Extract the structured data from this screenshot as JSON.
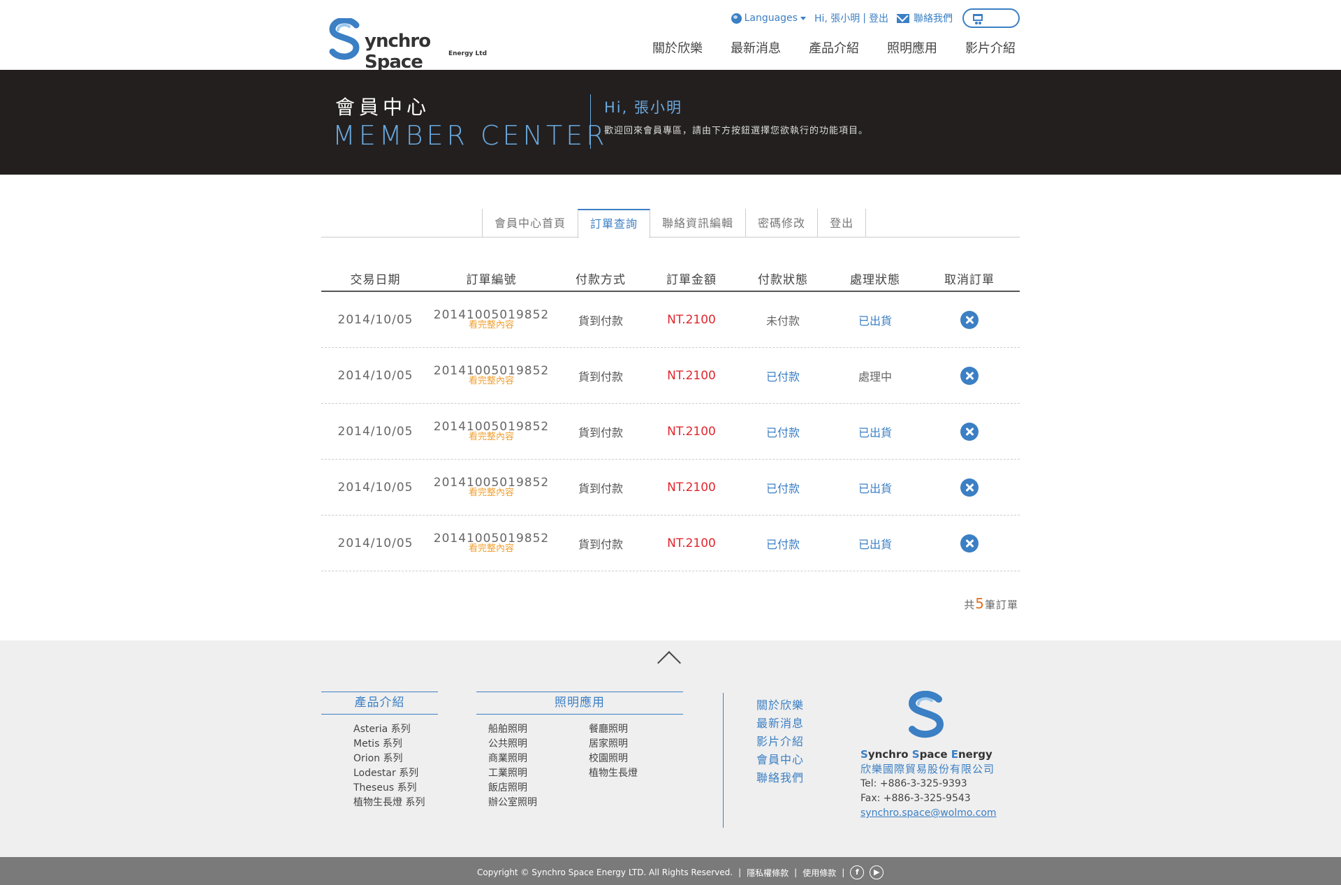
{
  "header": {
    "logo_text": "ynchro Space",
    "logo_sub": "Energy Ltd",
    "languages": "Languages",
    "greeting": "Hi, 張小明",
    "logout": "登出",
    "contact": "聯絡我們",
    "nav": [
      "關於欣樂",
      "最新消息",
      "產品介紹",
      "照明應用",
      "影片介紹"
    ]
  },
  "banner": {
    "title_cn": "會員中心",
    "title_en": "MEMBER CENTER",
    "hi": "Hi, 張小明",
    "desc": "歡迎回來會員專區，請由下方按鈕選擇您欲執行的功能項目。"
  },
  "tabs": [
    "會員中心首頁",
    "訂單查詢",
    "聯絡資訊編輯",
    "密碼修改",
    "登出"
  ],
  "table": {
    "headers": [
      "交易日期",
      "訂單編號",
      "付款方式",
      "訂單金額",
      "付款狀態",
      "處理狀態",
      "取消訂單"
    ],
    "link_label": "看完整內容",
    "rows": [
      {
        "date": "2014/10/05",
        "order_no": "20141005019852",
        "method": "貨到付款",
        "amount": "NT.2100",
        "pay_status": "未付款",
        "process": "已出貨",
        "pay_color": "#666666",
        "proc_color": "#3b7fc4"
      },
      {
        "date": "2014/10/05",
        "order_no": "20141005019852",
        "method": "貨到付款",
        "amount": "NT.2100",
        "pay_status": "已付款",
        "process": "處理中",
        "pay_color": "#3b7fc4",
        "proc_color": "#666666"
      },
      {
        "date": "2014/10/05",
        "order_no": "20141005019852",
        "method": "貨到付款",
        "amount": "NT.2100",
        "pay_status": "已付款",
        "process": "已出貨",
        "pay_color": "#3b7fc4",
        "proc_color": "#3b7fc4"
      },
      {
        "date": "2014/10/05",
        "order_no": "20141005019852",
        "method": "貨到付款",
        "amount": "NT.2100",
        "pay_status": "已付款",
        "process": "已出貨",
        "pay_color": "#3b7fc4",
        "proc_color": "#3b7fc4"
      },
      {
        "date": "2014/10/05",
        "order_no": "20141005019852",
        "method": "貨到付款",
        "amount": "NT.2100",
        "pay_status": "已付款",
        "process": "已出貨",
        "pay_color": "#3b7fc4",
        "proc_color": "#3b7fc4"
      }
    ]
  },
  "total": {
    "prefix": "共",
    "count": "5",
    "suffix": "筆訂單"
  },
  "footer": {
    "products_title": "產品介紹",
    "products": [
      "Asteria 系列",
      "Metis 系列",
      "Orion 系列",
      "Lodestar 系列",
      "Theseus 系列",
      "植物生長燈 系列"
    ],
    "lighting_title": "照明應用",
    "lighting_col1": [
      "船舶照明",
      "公共照明",
      "商業照明",
      "工業照明",
      "飯店照明",
      "辦公室照明"
    ],
    "lighting_col2": [
      "餐廳照明",
      "居家照明",
      "校園照明",
      "植物生長燈"
    ],
    "nav": [
      "關於欣樂",
      "最新消息",
      "影片介紹",
      "會員中心",
      "聯絡我們"
    ],
    "brand_s1": "S",
    "brand_w1": "ynchro ",
    "brand_s2": "S",
    "brand_w2": "pace ",
    "brand_s3": "E",
    "brand_w3": "nergy",
    "company": "欣樂國際貿易股份有限公司",
    "tel": "Tel: +886-3-325-9393",
    "fax": "Fax: +886-3-325-9543",
    "email": "synchro.space@wolmo.com"
  },
  "copyright": {
    "text": "Copyright © Synchro Space Energy LTD. All Rights Reserved.",
    "privacy": "隱私權條款",
    "terms": "使用條款",
    "facebook": "f",
    "youtube": "▶"
  },
  "colors": {
    "accent": "#3b7fc4",
    "banner_bg": "#231f1f",
    "amount": "#e0262d",
    "link": "#f0a030"
  },
  "icons": {
    "language": "globe-icon",
    "contact": "mail-icon",
    "cart": "cart-icon",
    "cancel": "close-circle-icon",
    "back_to_top": "chevron-up-icon"
  }
}
